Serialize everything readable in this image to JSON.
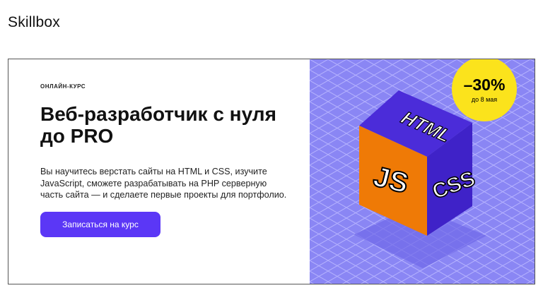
{
  "brand": {
    "logo_text": "Skillbox"
  },
  "course": {
    "eyebrow": "ОНЛАЙН-КУРС",
    "title": "Веб-разработчик с нуля до PRO",
    "description": "Вы научитесь верстать сайты на HTML и CSS, изучите JavaScript, сможете разрабатывать на PHP серверную часть сайта — и сделаете первые проекты для портфолио.",
    "cta_label": "Записаться на курс"
  },
  "promo": {
    "discount": "–30%",
    "until": "до 8 мая"
  },
  "cube": {
    "top_label": "HTML",
    "left_label": "JS",
    "right_label": "CSS"
  },
  "colors": {
    "accent": "#5b37f6",
    "art_background": "#8a86f4",
    "badge": "#fbe31c",
    "cube_left": "#ef7a06",
    "cube_right": "#3f22c8",
    "cube_top": "#4b2cd9"
  }
}
